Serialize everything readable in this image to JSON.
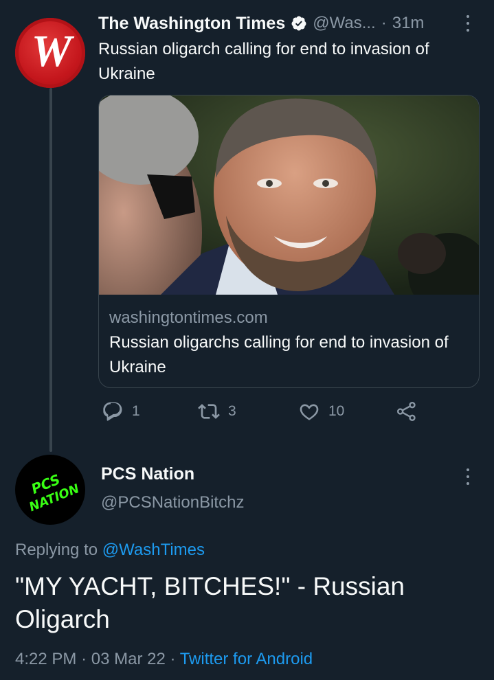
{
  "tweet1": {
    "author_name": "The Washington Times",
    "handle": "@Was...",
    "separator": "·",
    "time": "31m",
    "avatar_letter": "W",
    "text": "Russian oligarch calling for end to invasion of Ukraine",
    "card": {
      "domain": "washingtontimes.com",
      "title": "Russian oligarchs calling for end to invasion of Ukraine"
    },
    "actions": {
      "replies": "1",
      "retweets": "3",
      "likes": "10"
    }
  },
  "tweet2": {
    "author_name": "PCS Nation",
    "handle": "@PCSNationBitchz",
    "avatar_logo_text": "PCS NATION",
    "replying_prefix": "Replying to",
    "replying_handle": "@WashTimes",
    "text": "\"MY YACHT, BITCHES!\" - Russian Oligarch",
    "time": "4:22 PM",
    "date": "03 Mar 22",
    "separator": "·",
    "source": "Twitter for Android"
  },
  "icons": {
    "verified": "verified-badge-icon",
    "more": "more-vertical-icon",
    "reply": "reply-icon",
    "retweet": "retweet-icon",
    "like": "heart-icon",
    "share": "share-icon"
  },
  "colors": {
    "background": "#15202b",
    "text_primary": "#f7f9f9",
    "text_secondary": "#8b98a5",
    "link": "#1d9bf0",
    "border": "#38444d",
    "wt_red": "#c4161c",
    "pcs_green": "#39ff14"
  }
}
